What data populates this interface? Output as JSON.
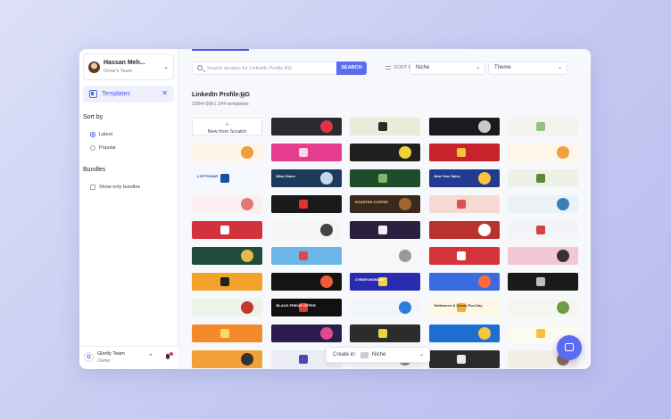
{
  "sidebar": {
    "user": {
      "name": "Hassan Meh...",
      "team": "Omar's Team"
    },
    "nav": {
      "templates_label": "Templates"
    },
    "sort": {
      "title": "Sort by",
      "options": [
        {
          "label": "Latest",
          "selected": true
        },
        {
          "label": "Popular",
          "selected": false
        }
      ]
    },
    "bundles": {
      "title": "Bundles",
      "show_only_label": "Show only bundles"
    },
    "team": {
      "logo_letter": "G",
      "name": "Glorify Team",
      "role": "Owner"
    }
  },
  "toolbar": {
    "search_placeholder": "Search designs for LinkedIn Profile BG",
    "search_button": "SEARCH",
    "sort_by_label": "SORT BY",
    "niche_dropdown": "Niche",
    "theme_dropdown": "Theme"
  },
  "content": {
    "title": "LinkedIn Profile BG",
    "subtitle": "1584×396 | 244 templates",
    "new_tile": {
      "plus": "+",
      "label": "New from Scratch"
    },
    "tiles": [
      {
        "bg": "#2a2a2e",
        "text": "",
        "fg": "#fff",
        "accent": "#e0334a"
      },
      {
        "bg": "#e8ecd8",
        "text": "",
        "fg": "#333",
        "accent": "#2b2b2b"
      },
      {
        "bg": "#1b1b1d",
        "text": "",
        "fg": "#fff",
        "accent": "#c9c9c9"
      },
      {
        "bg": "#f4f4ee",
        "text": "",
        "fg": "#555",
        "accent": "#93c47d"
      },
      {
        "bg": "#fdf3e6",
        "text": "",
        "fg": "#333",
        "accent": "#f29d38"
      },
      {
        "bg": "#e63c8f",
        "text": "",
        "fg": "#fff",
        "accent": "#ffd1e8"
      },
      {
        "bg": "#1f1f1f",
        "text": "",
        "fg": "#fff",
        "accent": "#f2d23a"
      },
      {
        "bg": "#c8232c",
        "text": "",
        "fg": "#fff",
        "accent": "#f7c23a"
      },
      {
        "bg": "#fff5e8",
        "text": "",
        "fg": "#333",
        "accent": "#f0a040"
      },
      {
        "bg": "#f5f8ff",
        "text": "LOFTCHAIR",
        "fg": "#1c4fa0",
        "accent": "#1c4fa0"
      },
      {
        "bg": "#1d3b5c",
        "text": "Miss Grace",
        "fg": "#fff",
        "accent": "#c9d6e8"
      },
      {
        "bg": "#1f4d2b",
        "text": "",
        "fg": "#fff",
        "accent": "#7fb86b"
      },
      {
        "bg": "#223a8f",
        "text": "New Year Sales",
        "fg": "#fff",
        "accent": "#f5c542"
      },
      {
        "bg": "#eef2e6",
        "text": "",
        "fg": "#333",
        "accent": "#5d8a3a"
      },
      {
        "bg": "#fbeeee",
        "text": "",
        "fg": "#333",
        "accent": "#e07a7a"
      },
      {
        "bg": "#1a1a1a",
        "text": "",
        "fg": "#fff",
        "accent": "#e5322d"
      },
      {
        "bg": "#3a2a1e",
        "text": "ROASTED COFFEE",
        "fg": "#f2d5a0",
        "accent": "#a0682f"
      },
      {
        "bg": "#f7d9d4",
        "text": "",
        "fg": "#333",
        "accent": "#d8534b"
      },
      {
        "bg": "#eaf2f8",
        "text": "",
        "fg": "#333",
        "accent": "#3c7fb8"
      },
      {
        "bg": "#d3313c",
        "text": "",
        "fg": "#fff",
        "accent": "#fff"
      },
      {
        "bg": "#f5f5f5",
        "text": "",
        "fg": "#333",
        "accent": "#444"
      },
      {
        "bg": "#2a2141",
        "text": "",
        "fg": "#fff",
        "accent": "#f2f2f2"
      },
      {
        "bg": "#b9322f",
        "text": "",
        "fg": "#fff",
        "accent": "#fff"
      },
      {
        "bg": "#f3f4f7",
        "text": "",
        "fg": "#333",
        "accent": "#d34141"
      },
      {
        "bg": "#1f4d3b",
        "text": "",
        "fg": "#fff",
        "accent": "#e8b84a"
      },
      {
        "bg": "#6ab7e8",
        "text": "",
        "fg": "#fff",
        "accent": "#e04a3a"
      },
      {
        "bg": "#f7f7f7",
        "text": "",
        "fg": "#333",
        "accent": "#999"
      },
      {
        "bg": "#d6323a",
        "text": "",
        "fg": "#fff",
        "accent": "#fff"
      },
      {
        "bg": "#f4c7d6",
        "text": "",
        "fg": "#333",
        "accent": "#333"
      },
      {
        "bg": "#f2a32b",
        "text": "",
        "fg": "#222",
        "accent": "#222"
      },
      {
        "bg": "#141414",
        "text": "",
        "fg": "#fff",
        "accent": "#f25a3a"
      },
      {
        "bg": "#2b2bb0",
        "text": "CYBER MONDAY",
        "fg": "#fff",
        "accent": "#f5d140"
      },
      {
        "bg": "#3a6ce0",
        "text": "",
        "fg": "#fff",
        "accent": "#ff6a3a"
      },
      {
        "bg": "#1a1a1a",
        "text": "",
        "fg": "#fff",
        "accent": "#bfbfbf"
      },
      {
        "bg": "#eef3ea",
        "text": "",
        "fg": "#333",
        "accent": "#c0392b"
      },
      {
        "bg": "#111111",
        "text": "BLACK FRIDAY OFFER",
        "fg": "#fff",
        "accent": "#e03a2f"
      },
      {
        "bg": "#f2f6fb",
        "text": "",
        "fg": "#333",
        "accent": "#2d7ed8"
      },
      {
        "bg": "#fff8e6",
        "text": "Halloween & Candy Fun Day",
        "fg": "#333",
        "accent": "#f2b233"
      },
      {
        "bg": "#f4f6ef",
        "text": "",
        "fg": "#333",
        "accent": "#6b9b4b"
      },
      {
        "bg": "#f28a2c",
        "text": "",
        "fg": "#fff",
        "accent": "#ffd86b"
      },
      {
        "bg": "#2b1e4f",
        "text": "",
        "fg": "#fff",
        "accent": "#e04a8a"
      },
      {
        "bg": "#2c2c2c",
        "text": "",
        "fg": "#fff",
        "accent": "#f2d23a"
      },
      {
        "bg": "#1c6fd0",
        "text": "",
        "fg": "#fff",
        "accent": "#f5c542"
      },
      {
        "bg": "#fdfaf0",
        "text": "",
        "fg": "#333",
        "accent": "#f2c23a"
      },
      {
        "bg": "#f2a13a",
        "text": "",
        "fg": "#fff",
        "accent": "#333"
      },
      {
        "bg": "#ececf7",
        "text": "",
        "fg": "#333",
        "accent": "#4a4ab0"
      },
      {
        "bg": "#f4f4f4",
        "text": "",
        "fg": "#333",
        "accent": "#888"
      },
      {
        "bg": "#2b2b2b",
        "text": "",
        "fg": "#fff",
        "accent": "#e9e9e9"
      },
      {
        "bg": "#f3efe6",
        "text": "",
        "fg": "#333",
        "accent": "#8a6a4a"
      }
    ]
  },
  "create_bar": {
    "label": "Create in:",
    "niche": "Niche"
  },
  "colors": {
    "accent": "#5b6cf0",
    "notification": "#e8334f"
  }
}
